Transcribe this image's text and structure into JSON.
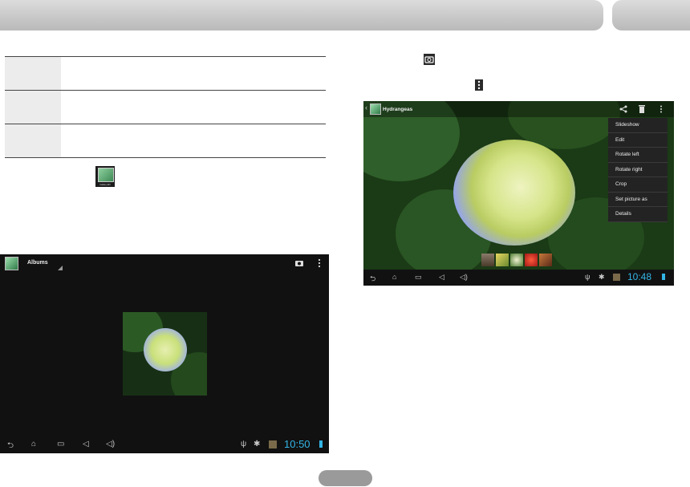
{
  "left_screen": {
    "title": "Albums",
    "clock": "10:50",
    "icons": [
      "gallery-app-icon",
      "camera-icon",
      "overflow-menu-icon",
      "back-icon",
      "home-icon",
      "recent-apps-icon",
      "volume-down-icon",
      "volume-up-icon",
      "usb-icon",
      "android-debug-icon",
      "status-icon",
      "battery-icon"
    ]
  },
  "right_screen": {
    "title": "Hydrangeas",
    "clock": "10:48",
    "menu_items": [
      "Slideshow",
      "Edit",
      "Rotate left",
      "Rotate right",
      "Crop",
      "Set picture as",
      "Details"
    ]
  },
  "gallery_icon_label": "Gallery3D",
  "colors": {
    "clock": "#33b5e5",
    "header_gray": "#c8c8c8",
    "screen_bg": "#111111"
  }
}
